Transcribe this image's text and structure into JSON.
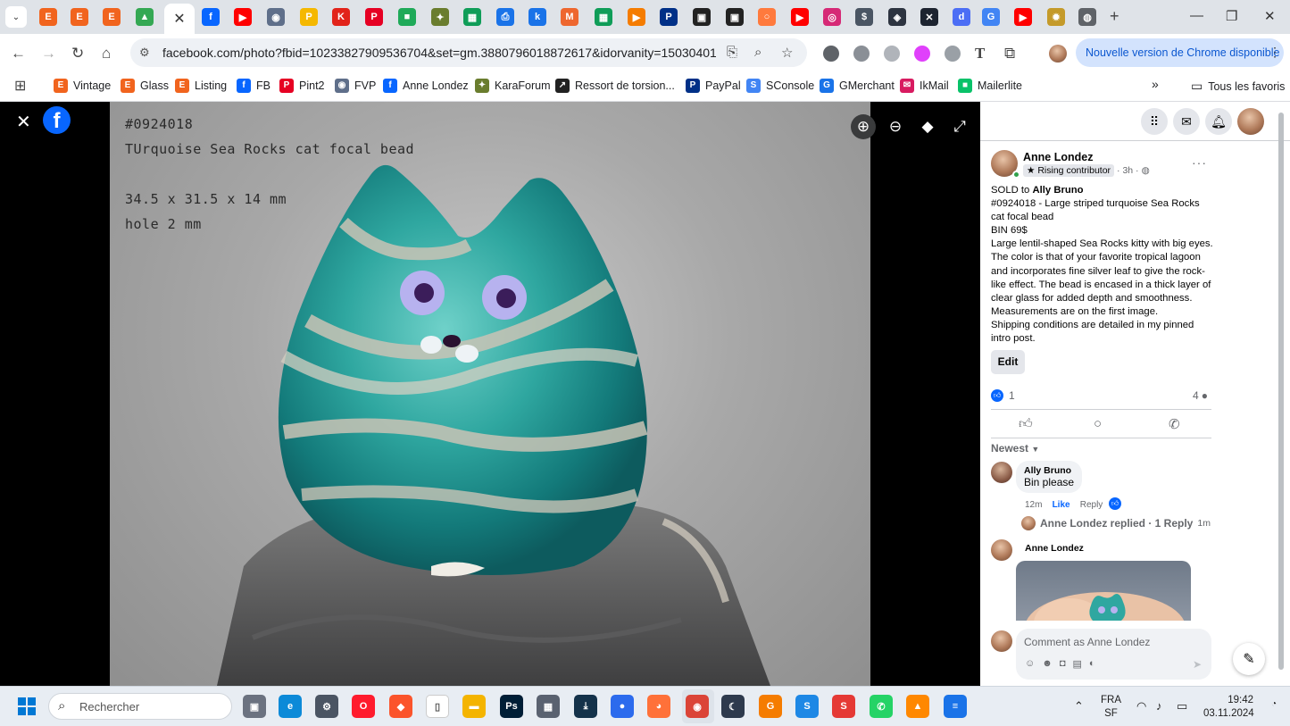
{
  "browser": {
    "url": "facebook.com/photo?fbid=10233827909536704&set=gm.3880796018872617&idorvanity=15030401666...",
    "update_label": "Nouvelle version de Chrome disponible",
    "tabs": [
      {
        "icon": "etsy-icon",
        "color": "#f1641e",
        "glyph": "E"
      },
      {
        "icon": "etsy-circle-icon",
        "color": "#f1641e",
        "glyph": "E"
      },
      {
        "icon": "etsy-circle-icon",
        "color": "#f1641e",
        "glyph": "E"
      },
      {
        "icon": "google-drive-icon",
        "color": "#34a853",
        "glyph": "▲"
      },
      {
        "icon": "facebook-icon",
        "color": "#0866ff",
        "glyph": "f"
      },
      {
        "icon": "youtube-icon",
        "color": "#ff0000",
        "glyph": "▶"
      },
      {
        "icon": "fvp-icon",
        "color": "#5f6f8a",
        "glyph": "◉"
      },
      {
        "icon": "pp-icon",
        "color": "#f5b800",
        "glyph": "P"
      },
      {
        "icon": "k-red-icon",
        "color": "#e2231a",
        "glyph": "K"
      },
      {
        "icon": "pinterest-icon",
        "color": "#e60023",
        "glyph": "P"
      },
      {
        "icon": "chat-green-icon",
        "color": "#1faa59",
        "glyph": "■"
      },
      {
        "icon": "karaforum-icon",
        "color": "#6a7d2e",
        "glyph": "✦"
      },
      {
        "icon": "sheets-icon",
        "color": "#0f9d58",
        "glyph": "▦"
      },
      {
        "icon": "print-icon",
        "color": "#1a73e8",
        "glyph": "⎙"
      },
      {
        "icon": "k-blue-icon",
        "color": "#1a73e8",
        "glyph": "k"
      },
      {
        "icon": "magento-icon",
        "color": "#ee672f",
        "glyph": "M"
      },
      {
        "icon": "sheets-icon",
        "color": "#0f9d58",
        "glyph": "▦"
      },
      {
        "icon": "play-orange-icon",
        "color": "#f57c00",
        "glyph": "▶"
      },
      {
        "icon": "paypal-icon",
        "color": "#003087",
        "glyph": "P"
      },
      {
        "icon": "pixel-icon",
        "color": "#222222",
        "glyph": "▣"
      },
      {
        "icon": "pixel-icon",
        "color": "#222222",
        "glyph": "▣"
      },
      {
        "icon": "orange-circle-icon",
        "color": "#ff7a3d",
        "glyph": "○"
      },
      {
        "icon": "youtube-icon",
        "color": "#ff0000",
        "glyph": "▶"
      },
      {
        "icon": "instagram-icon",
        "color": "#d62976",
        "glyph": "◎"
      },
      {
        "icon": "coin-icon",
        "color": "#4a5563",
        "glyph": "$"
      },
      {
        "icon": "compass-icon",
        "color": "#2d3440",
        "glyph": "◈"
      },
      {
        "icon": "bluesky-icon",
        "color": "#1d2430",
        "glyph": "✕"
      },
      {
        "icon": "d-circle-icon",
        "color": "#4c6ef5",
        "glyph": "d"
      },
      {
        "icon": "google-icon",
        "color": "#4285f4",
        "glyph": "G"
      },
      {
        "icon": "youtube-icon",
        "color": "#ff0000",
        "glyph": "▶"
      },
      {
        "icon": "badge-gold-icon",
        "color": "#c49a2a",
        "glyph": "✹"
      },
      {
        "icon": "globe-icon",
        "color": "#5f6368",
        "glyph": "◍"
      }
    ],
    "extensions": [
      {
        "icon": "vpn-icon",
        "color": "#5f6368"
      },
      {
        "icon": "code-icon",
        "color": "#8a8f96"
      },
      {
        "icon": "k-ext-icon",
        "color": "#b0b4ba"
      },
      {
        "icon": "pink-arrow-icon",
        "color": "#e040fb"
      },
      {
        "icon": "gear-ext-icon",
        "color": "#9aa0a6"
      }
    ],
    "bookmarks": [
      {
        "label": "Vintage",
        "icon": "etsy-icon",
        "color": "#f1641e",
        "glyph": "E"
      },
      {
        "label": "Glass",
        "icon": "etsy-icon",
        "color": "#f1641e",
        "glyph": "E"
      },
      {
        "label": "Listing",
        "icon": "etsy-icon",
        "color": "#f1641e",
        "glyph": "E"
      },
      {
        "label": "FB",
        "icon": "facebook-icon",
        "color": "#0866ff",
        "glyph": "f"
      },
      {
        "label": "Pint2",
        "icon": "pinterest-icon",
        "color": "#e60023",
        "glyph": "P"
      },
      {
        "label": "FVP",
        "icon": "fvp-icon",
        "color": "#5f6f8a",
        "glyph": "◉"
      },
      {
        "label": "Anne Londez",
        "icon": "facebook-icon",
        "color": "#0866ff",
        "glyph": "f"
      },
      {
        "label": "KaraForum",
        "icon": "karaforum-icon",
        "color": "#6a7d2e",
        "glyph": "✦"
      },
      {
        "label": "Ressort de torsion...",
        "icon": "ressort-icon",
        "color": "#222222",
        "glyph": "↗"
      },
      {
        "label": "PayPal",
        "icon": "paypal-icon",
        "color": "#003087",
        "glyph": "P"
      },
      {
        "label": "SConsole",
        "icon": "sconsole-icon",
        "color": "#4285f4",
        "glyph": "S"
      },
      {
        "label": "GMerchant",
        "icon": "gmerchant-icon",
        "color": "#1a73e8",
        "glyph": "G"
      },
      {
        "label": "IkMail",
        "icon": "ikmail-icon",
        "color": "#d81b60",
        "glyph": "✉"
      },
      {
        "label": "Mailerlite",
        "icon": "mailerlite-icon",
        "color": "#09c269",
        "glyph": "■"
      }
    ],
    "bookmarks_all": "Tous les favoris",
    "bookmarks_more": "»"
  },
  "photo": {
    "caption_id": "#0924018",
    "caption_title": "TUrquoise Sea Rocks cat focal bead",
    "caption_size": "34.5 x 31.5 x 14 mm",
    "caption_hole": "hole 2 mm"
  },
  "post": {
    "author": "Anne Londez",
    "badge": "Rising contributor",
    "time": "· 3h ·",
    "sold_prefix": "SOLD to",
    "sold_to": "Ally Bruno",
    "lines": [
      "#0924018 - Large striped turquoise Sea Rocks cat focal bead",
      "BIN 69$",
      "Large lentil-shaped Sea Rocks kitty with big eyes. The color is that of your favorite tropical lagoon and incorporates fine silver leaf to give the rock-like effect. The bead is encased in a thick layer of clear glass for added depth and smoothness.",
      "Measurements are on the first image.",
      "Shipping conditions are detailed in my pinned intro post."
    ],
    "edit_label": "Edit",
    "like_count": "1",
    "comment_count": "4",
    "sort_label": "Newest"
  },
  "comments": [
    {
      "name": "Ally Bruno",
      "text": "Bin please",
      "time": "12m",
      "like": "Like",
      "reply": "Reply"
    },
    {
      "replied": "Anne Londez replied · 1 Reply",
      "time": "1m"
    },
    {
      "name": "Anne Londez"
    }
  ],
  "composer": {
    "placeholder": "Comment as Anne Londez"
  },
  "taskbar": {
    "search_placeholder": "Rechercher",
    "lang": "FRA",
    "layout": "SF",
    "time": "19:42",
    "date": "03.11.2024",
    "apps": [
      {
        "icon": "task-view-icon",
        "color": "#6b7280",
        "glyph": "▣"
      },
      {
        "icon": "edge-icon",
        "color": "#0c8ad8",
        "glyph": "e"
      },
      {
        "icon": "settings-icon",
        "color": "#4b5563",
        "glyph": "⚙"
      },
      {
        "icon": "opera-icon",
        "color": "#ff1b2d",
        "glyph": "O"
      },
      {
        "icon": "brave-icon",
        "color": "#fb542b",
        "glyph": "◆"
      },
      {
        "icon": "file-icon",
        "color": "#ffffff",
        "glyph": "▯"
      },
      {
        "icon": "explorer-icon",
        "color": "#f4b400",
        "glyph": "▬"
      },
      {
        "icon": "photoshop-icon",
        "color": "#001e36",
        "glyph": "Ps"
      },
      {
        "icon": "calculator-icon",
        "color": "#5a6270",
        "glyph": "▦"
      },
      {
        "icon": "download-icon",
        "color": "#14324a",
        "glyph": "⤓"
      },
      {
        "icon": "signal-icon",
        "color": "#2c6bed",
        "glyph": "●"
      },
      {
        "icon": "firefox-icon",
        "color": "#ff7139",
        "glyph": "◕"
      },
      {
        "icon": "chrome-icon",
        "color": "#db4437",
        "glyph": "◉"
      },
      {
        "icon": "moon-app-icon",
        "color": "#2e3a4d",
        "glyph": "☾"
      },
      {
        "icon": "g-orange-icon",
        "color": "#f57c00",
        "glyph": "G"
      },
      {
        "icon": "s-blue-icon",
        "color": "#1e88e5",
        "glyph": "S"
      },
      {
        "icon": "s-red-icon",
        "color": "#e53935",
        "glyph": "S"
      },
      {
        "icon": "whatsapp-icon",
        "color": "#25d366",
        "glyph": "✆"
      },
      {
        "icon": "vlc-icon",
        "color": "#ff8800",
        "glyph": "▲"
      },
      {
        "icon": "docs-icon",
        "color": "#1a73e8",
        "glyph": "≡"
      }
    ]
  }
}
